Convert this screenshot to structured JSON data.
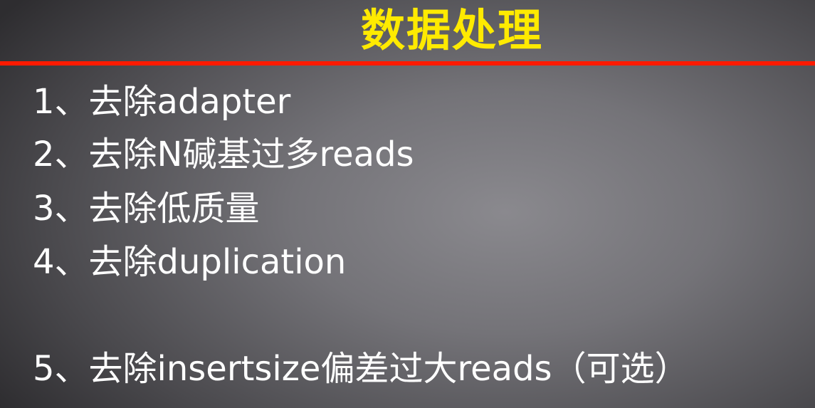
{
  "slide": {
    "title": "数据处理",
    "colors": {
      "title": "#ffea00",
      "rule": "#ff1a00",
      "text": "#ffffff",
      "background": "#77767b"
    },
    "steps": [
      "1、去除adapter",
      "2、去除N碱基过多reads",
      "3、去除低质量",
      "4、去除duplication",
      "5、去除insertsize偏差过大reads（可选）"
    ]
  }
}
